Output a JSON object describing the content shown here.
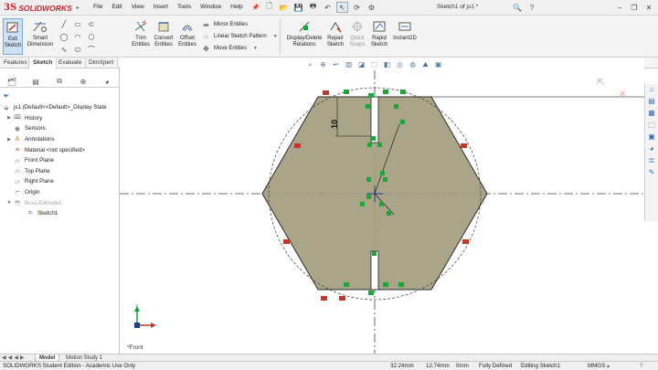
{
  "titlebar": {
    "logo_ds": "3S",
    "logo_text": "SOLIDWORKS",
    "menus": [
      "File",
      "Edit",
      "View",
      "Insert",
      "Tools",
      "Window",
      "Help"
    ],
    "document_title": "Sketch1 of js1 *",
    "quick_icons": [
      "new-icon",
      "open-icon",
      "save-icon",
      "print-icon",
      "undo-icon",
      "select-icon",
      "rebuild-icon",
      "options-icon"
    ]
  },
  "command_manager": {
    "exit_sketch": "Exit Sketch",
    "smart_dimension": "Smart Dimension",
    "trim_entities": "Trim Entities",
    "convert_entities": "Convert Entities",
    "offset_entities": "Offset Entities",
    "mirror_entities": "Mirror Entities",
    "linear_sketch_pattern": "Linear Sketch Pattern",
    "move_entities": "Move Entities",
    "display_delete_relations": "Display/Delete Relations",
    "repair_sketch": "Repair Sketch",
    "quick_snaps": "Quick Snaps",
    "rapid_sketch": "Rapid Sketch",
    "instant2d": "Instant2D"
  },
  "tabs": [
    "Features",
    "Sketch",
    "Evaluate",
    "DimXpert"
  ],
  "active_tab": "Sketch",
  "feature_tree": {
    "items": [
      {
        "label": "js1  (Default<<Default>_Display State",
        "icon": "part-icon",
        "indent": 0,
        "expander": ""
      },
      {
        "label": "History",
        "icon": "history-icon",
        "indent": 1,
        "expander": "▶"
      },
      {
        "label": "Sensors",
        "icon": "sensor-icon",
        "indent": 1,
        "expander": ""
      },
      {
        "label": "Annotations",
        "icon": "annotation-icon",
        "indent": 1,
        "expander": "▶"
      },
      {
        "label": "Material <not specified>",
        "icon": "material-icon",
        "indent": 1,
        "expander": ""
      },
      {
        "label": "Front Plane",
        "icon": "plane-icon",
        "indent": 1,
        "expander": ""
      },
      {
        "label": "Top Plane",
        "icon": "plane-icon",
        "indent": 1,
        "expander": ""
      },
      {
        "label": "Right Plane",
        "icon": "plane-icon",
        "indent": 1,
        "expander": ""
      },
      {
        "label": "Origin",
        "icon": "origin-icon",
        "indent": 1,
        "expander": ""
      },
      {
        "label": "Boss-Extrude1",
        "icon": "extrude-icon",
        "indent": 1,
        "expander": "▼",
        "dim": true
      },
      {
        "label": "Sketch1",
        "icon": "sketch-icon",
        "indent": 2,
        "expander": ""
      }
    ]
  },
  "bottom_tabs": [
    "Model",
    "Motion Study 1"
  ],
  "active_bottom_tab": "Model",
  "graphics": {
    "view_label": "*Front",
    "dimension_value": "10",
    "sketch_fill": "#a39c7f",
    "relation_color": "#1aa83a"
  },
  "statusbar": {
    "edition": "SOLIDWORKS Student Edition - Academic Use Only",
    "x": "32.24mm",
    "y": "12.74mm",
    "z": "0mm",
    "state": "Fully Defined",
    "mode": "Editing Sketch1",
    "units": "MMGS"
  }
}
